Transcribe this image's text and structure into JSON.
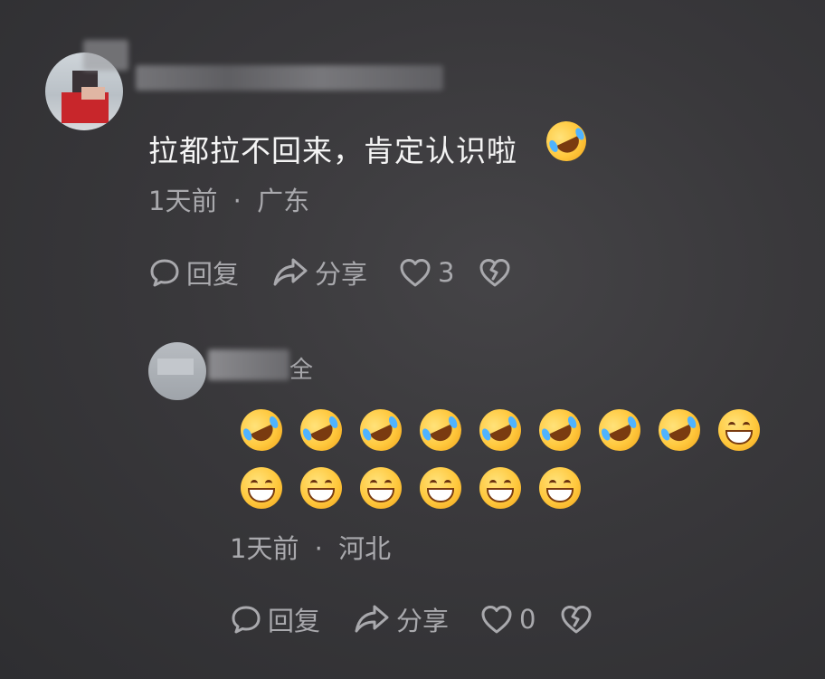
{
  "comment": {
    "text": "拉都拉不回来，肯定认识啦",
    "time": "1天前",
    "location": "广东",
    "reply_label": "回复",
    "share_label": "分享",
    "like_count": "3",
    "emoji": "rofl-emoji"
  },
  "reply": {
    "username_tail": "全",
    "emojis": [
      "rofl",
      "rofl",
      "rofl",
      "rofl",
      "rofl",
      "rofl",
      "rofl",
      "rofl",
      "grin",
      "grin",
      "grin",
      "grin",
      "grin",
      "grin",
      "grin"
    ],
    "time": "1天前",
    "location": "河北",
    "reply_label": "回复",
    "share_label": "分享",
    "like_count": "0"
  },
  "separator": "·",
  "colors": {
    "background": "#39383b",
    "text": "#f4f4f4",
    "muted": "#a9a9ad"
  }
}
